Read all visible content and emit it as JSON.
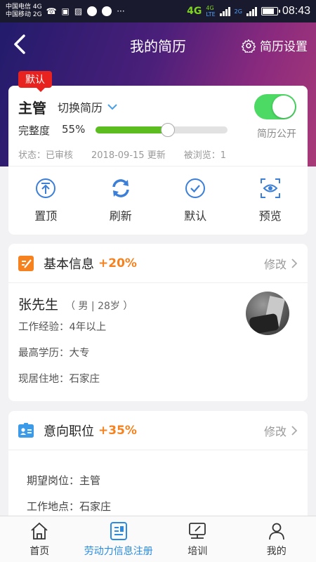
{
  "status_bar": {
    "carrier1": "中国电信 4G",
    "carrier2": "中国移动 2G",
    "network_main": "4G",
    "network_a1": "4G",
    "network_a2": "LTE",
    "network_b": "2G",
    "time": "08:43",
    "more": "···"
  },
  "header": {
    "title": "我的简历",
    "settings_label": "简历设置"
  },
  "resume": {
    "default_tag": "默认",
    "title": "主管",
    "switch_label": "切换简历",
    "public_label": "简历公开",
    "public_on": true,
    "completeness_label": "完整度",
    "completeness_value": "55%",
    "completeness_fraction": 0.55,
    "status": "状态：已审核",
    "updated": "2018-09-15 更新",
    "views": "被浏览：1",
    "actions": [
      "置顶",
      "刷新",
      "默认",
      "预览"
    ]
  },
  "basic_info": {
    "title": "基本信息",
    "percent": "+20%",
    "edit_label": "修改",
    "name": "张先生",
    "gender_age": "（ 男 | 28岁 ）",
    "experience": "工作经验：4年以上",
    "education": "最高学历：大专",
    "residence": "现居住地：石家庄"
  },
  "intent": {
    "title": "意向职位",
    "percent": "+35%",
    "edit_label": "修改",
    "position": "期望岗位：主管",
    "location": "工作地点：石家庄"
  },
  "bottom_nav": {
    "tabs": [
      "首页",
      "劳动力信息注册",
      "培训",
      "我的"
    ],
    "active_index": 1
  },
  "colors": {
    "accent": "#2a8be0",
    "percent": "#f5821f",
    "toggle_on": "#4cd964",
    "progress": "#5cbd21",
    "tag": "#e8231f"
  }
}
